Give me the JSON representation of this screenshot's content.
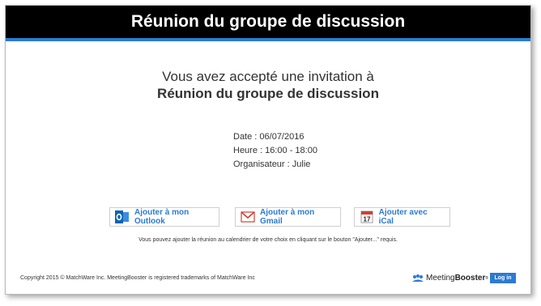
{
  "header": {
    "title": "Réunion du groupe de discussion"
  },
  "main": {
    "accepted_text": "Vous avez accepté une invitation à",
    "meeting_name": "Réunion du groupe de discussion",
    "details": {
      "date": "Date : 06/07/2016",
      "time": "Heure : 16:00 - 18:00",
      "organizer": "Organisateur : Julie"
    },
    "buttons": {
      "outlook": "Ajouter à mon Outlook",
      "gmail": "Ajouter à mon Gmail",
      "ical": "Ajouter avec iCal"
    },
    "note": "Vous pouvez ajouter la réunion au calendrier de votre choix en cliquant sur le bouton \"Ajouter...\" requis."
  },
  "footer": {
    "copyright": "Copyright 2015 © MatchWare Inc.  MeetingBooster is registered trademarks of MatchWare Inc",
    "brand_prefix": "Meeting",
    "brand_suffix": "Booster",
    "brand_tm": "®",
    "login_label": "Log in"
  },
  "colors": {
    "accent": "#2b7bd3",
    "header_bg": "#000000",
    "outlook": "#0a64b4",
    "gmail": "#d23f31",
    "ical": "#d23f31"
  },
  "icons": [
    "outlook-icon",
    "gmail-icon",
    "calendar-icon",
    "meetingbooster-logo-icon"
  ]
}
